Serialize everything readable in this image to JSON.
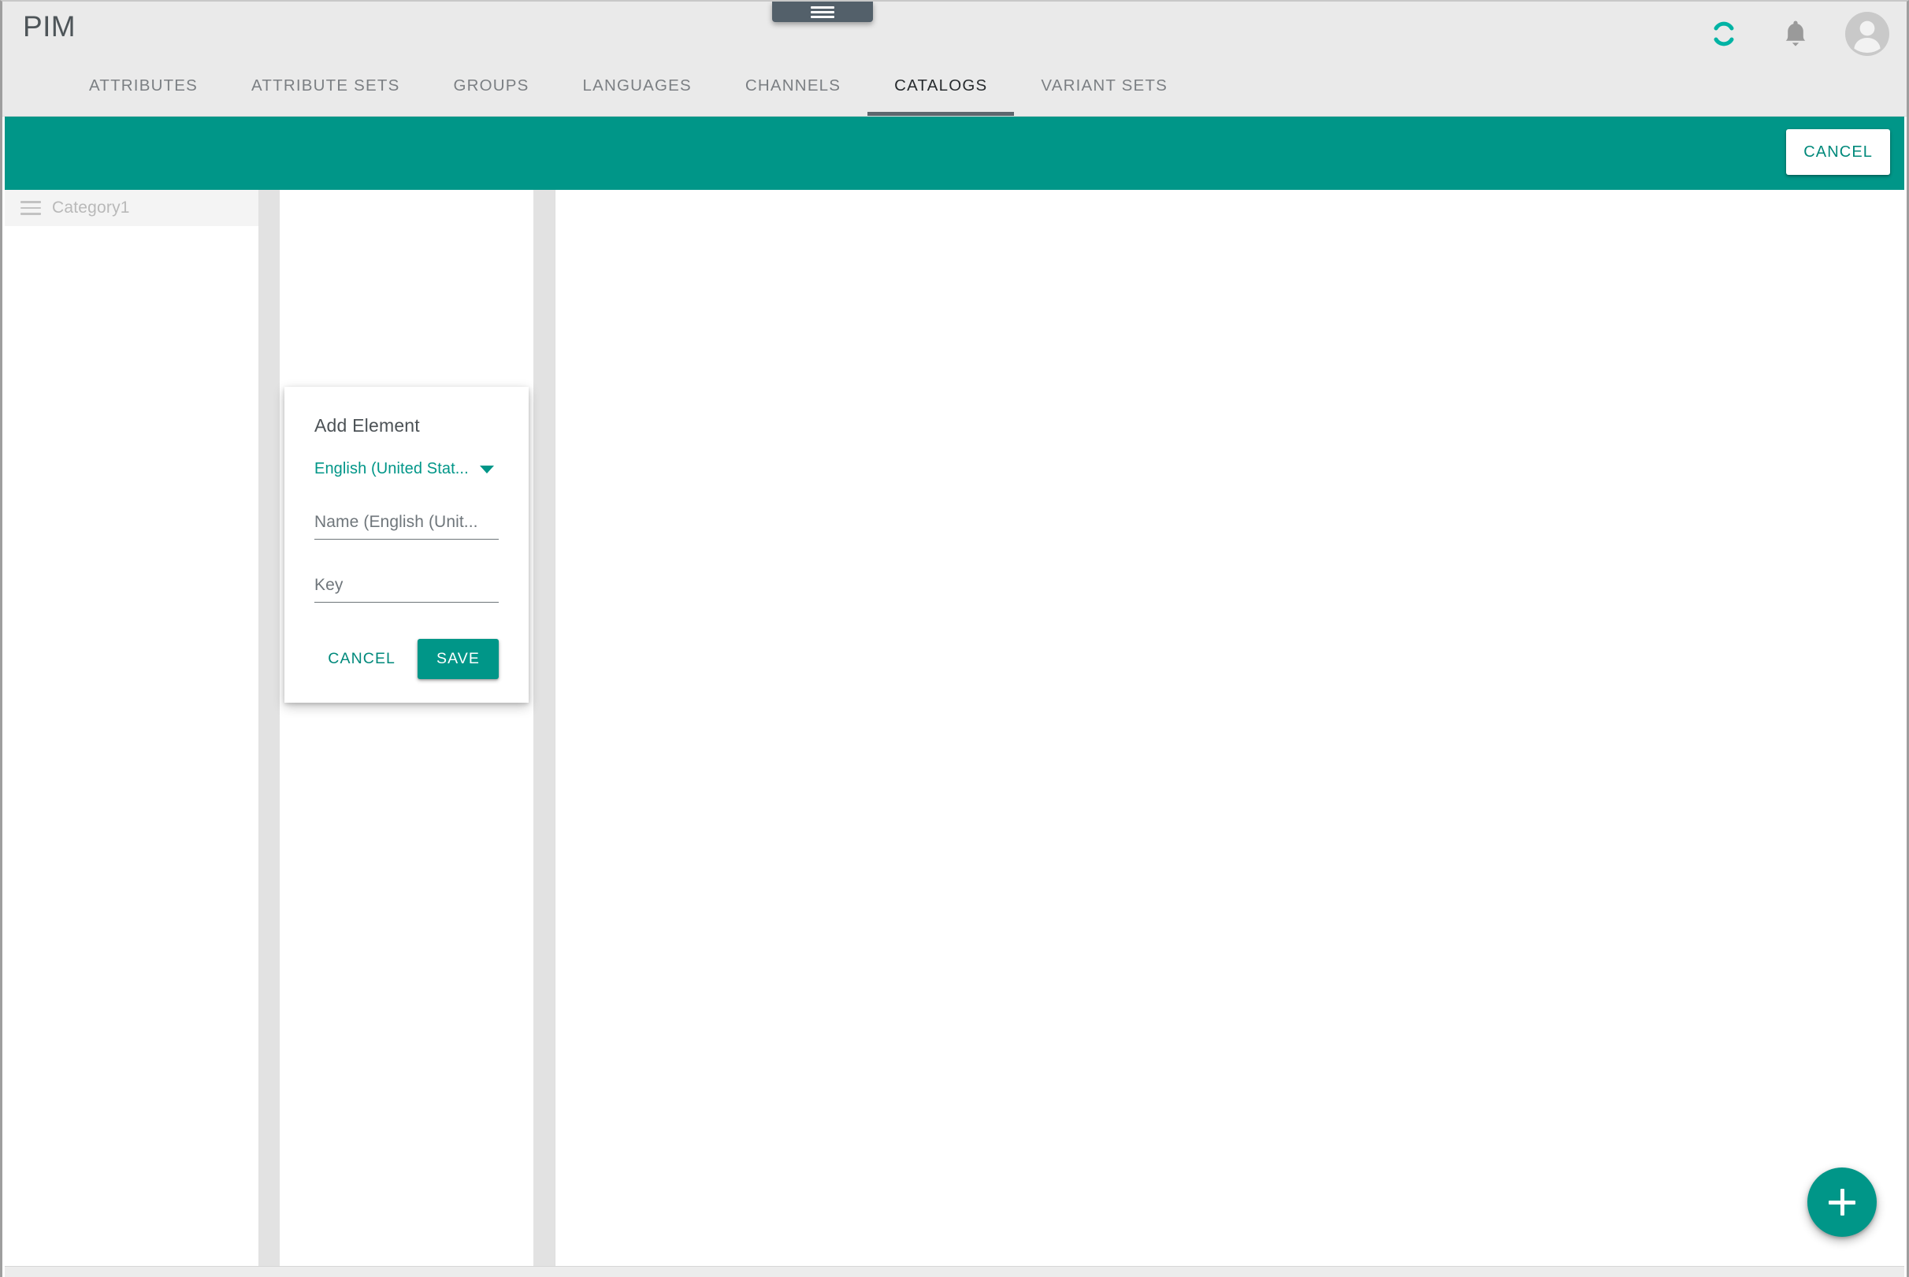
{
  "window": {
    "drag_handle_icon": "hamburger-handle-icon"
  },
  "header": {
    "app_title": "PIM",
    "actions": [
      {
        "name": "sync-spinner-icon",
        "label": ""
      },
      {
        "name": "notifications-bell-icon",
        "label": ""
      },
      {
        "name": "user-avatar",
        "label": ""
      }
    ],
    "tabs": [
      {
        "label": "ATTRIBUTES",
        "active": false
      },
      {
        "label": "ATTRIBUTE SETS",
        "active": false
      },
      {
        "label": "GROUPS",
        "active": false
      },
      {
        "label": "LANGUAGES",
        "active": false
      },
      {
        "label": "CHANNELS",
        "active": false
      },
      {
        "label": "CATALOGS",
        "active": true
      },
      {
        "label": "VARIANT SETS",
        "active": false
      }
    ]
  },
  "action_bar": {
    "cancel_label": "CANCEL"
  },
  "tree": {
    "items": [
      {
        "label": "Category1",
        "drag_icon": "drag-handle-icon"
      }
    ]
  },
  "dialog": {
    "title": "Add Element",
    "language_value": "English (United Stat...",
    "name_field": {
      "value": "",
      "placeholder": "Name (English (Unit..."
    },
    "key_field": {
      "value": "",
      "placeholder": "Key"
    },
    "cancel_label": "CANCEL",
    "save_label": "SAVE"
  },
  "fab": {
    "icon": "plus-icon",
    "label": "+"
  },
  "colors": {
    "accent_teal": "#009688",
    "accent_teal_dark": "#00897b",
    "header_gray": "#eaeaea",
    "tab_active_underline": "#5d676e",
    "gutter_gray": "#e2e2e2",
    "tree_row_gray": "#f4f4f4",
    "tree_label_gray": "#b9b9b9",
    "drag_handle_slate": "#53606a"
  }
}
